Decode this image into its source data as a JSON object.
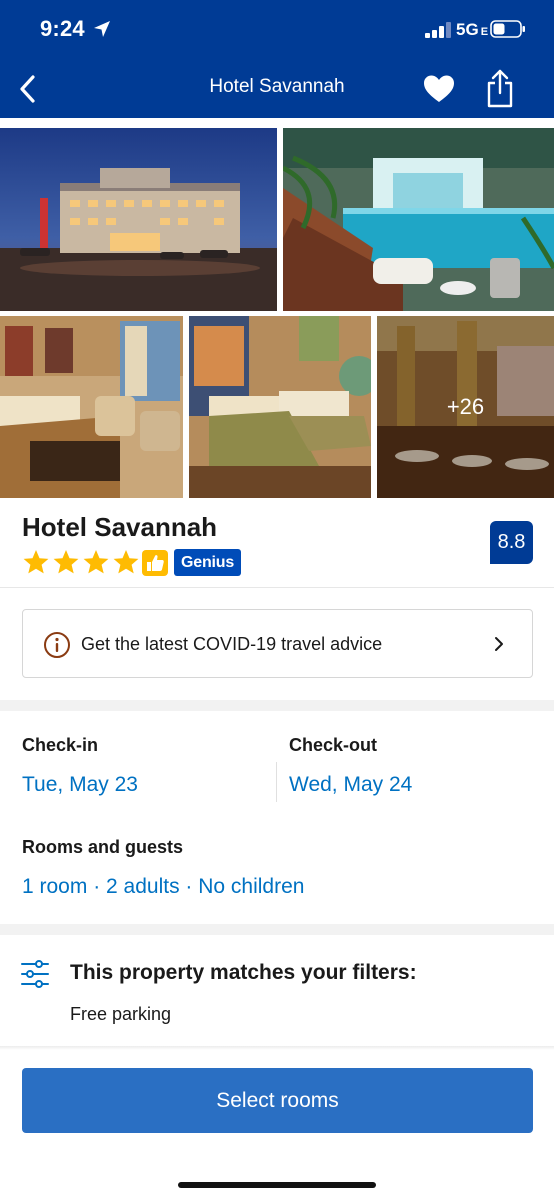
{
  "status_bar": {
    "time": "9:24",
    "network": "5G",
    "network_suffix": "E"
  },
  "nav": {
    "title": "Hotel Savannah",
    "back_icon": "chevron-left-icon",
    "favorite_icon": "heart-icon",
    "share_icon": "share-icon"
  },
  "photos": {
    "more_count": "+26"
  },
  "hotel": {
    "name": "Hotel Savannah",
    "stars": 4,
    "genius_label": "Genius",
    "score": "8.8"
  },
  "covid": {
    "text": "Get the latest COVID-19 travel advice"
  },
  "dates": {
    "checkin_label": "Check-in",
    "checkin_value": "Tue, May 23",
    "checkout_label": "Check-out",
    "checkout_value": "Wed, May 24"
  },
  "guests": {
    "label": "Rooms and guests",
    "value": "1 room · 2 adults · No children"
  },
  "filters": {
    "title": "This property matches your filters:",
    "items": [
      "Free parking"
    ]
  },
  "cta": {
    "label": "Select rooms"
  },
  "colors": {
    "brand_dark_blue": "#003b95",
    "link_blue": "#0071c2",
    "button_blue": "#2a6fc3",
    "star_yellow": "#febb02"
  }
}
